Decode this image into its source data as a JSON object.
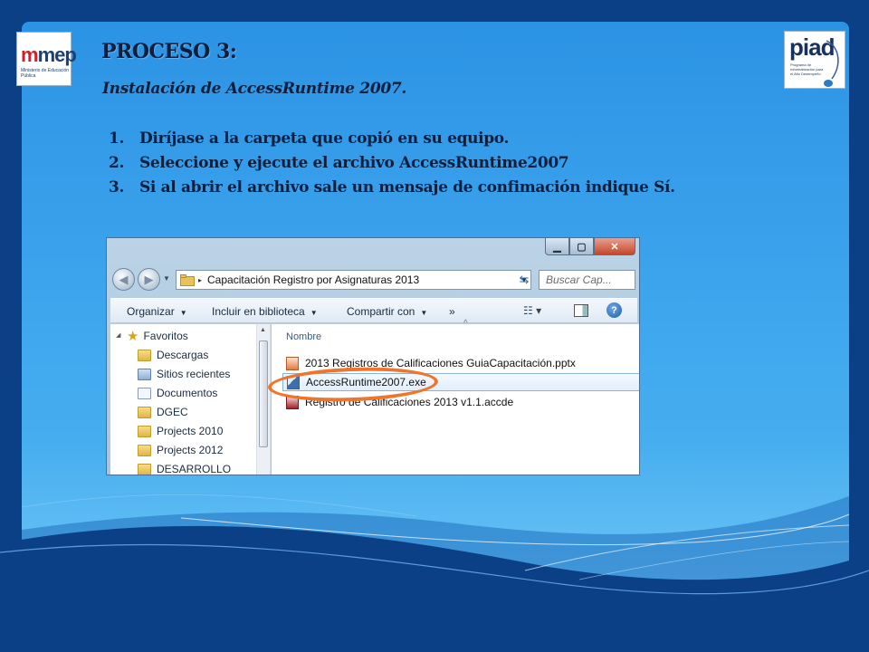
{
  "slide": {
    "title": "PROCESO 3:",
    "subtitle": "Instalación de AccessRuntime 2007.",
    "steps": [
      {
        "num": "1.",
        "text": "Diríjase a la carpeta que copió en su equipo."
      },
      {
        "num": "2.",
        "text": "Seleccione y ejecute el archivo AccessRuntime2007"
      },
      {
        "num": "3.",
        "text": "Si al abrir el archivo sale un mensaje de confimación indique Sí."
      }
    ],
    "colors": {
      "background": "#0b3f86",
      "panel": "#3aa2ec",
      "text": "#0d1f3c",
      "highlight": "#f0752b"
    }
  },
  "logos": {
    "mep": {
      "word": "mep",
      "caption": "Ministerio de Educación Pública"
    },
    "piad": {
      "word": "piad",
      "caption": "Programa de Informatización para el Alto Desempeño"
    }
  },
  "explorer": {
    "window_buttons": {
      "minimize": "▁",
      "maximize": "▢",
      "close": "✕"
    },
    "address": {
      "path": "Capacitación Registro por Asignaturas 2013",
      "separator": "▸"
    },
    "search": {
      "placeholder": "Buscar Cap..."
    },
    "toolbar": {
      "organize": "Organizar",
      "include_library": "Incluir en biblioteca",
      "share_with": "Compartir con",
      "more": "»"
    },
    "nav_pane": {
      "favorites_label": "Favoritos",
      "items": [
        {
          "label": "Descargas",
          "icon": "download-folder-icon"
        },
        {
          "label": "Sitios recientes",
          "icon": "recent-places-icon"
        },
        {
          "label": "Documentos",
          "icon": "documents-icon"
        },
        {
          "label": "DGEC",
          "icon": "folder-icon"
        },
        {
          "label": "Projects 2010",
          "icon": "folder-icon"
        },
        {
          "label": "Projects 2012",
          "icon": "folder-icon"
        },
        {
          "label": "DESARROLLO",
          "icon": "folder-icon"
        }
      ]
    },
    "files": {
      "column_header": "Nombre",
      "items": [
        {
          "name": "2013 Registros de Calificaciones GuiaCapacitación.pptx",
          "type": "pptx",
          "selected": false
        },
        {
          "name": "AccessRuntime2007.exe",
          "type": "exe",
          "selected": true
        },
        {
          "name": "Registro de Calificaciones 2013 v1.1.accde",
          "type": "accde",
          "selected": false
        }
      ]
    }
  }
}
